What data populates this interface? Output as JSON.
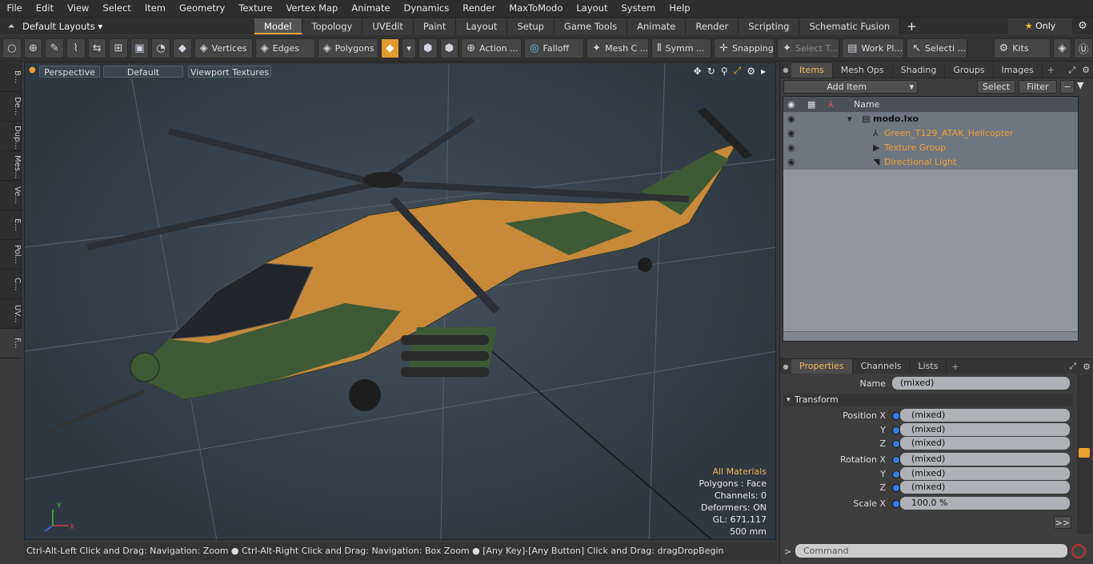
{
  "menu": [
    "File",
    "Edit",
    "View",
    "Select",
    "Item",
    "Geometry",
    "Texture",
    "Vertex Map",
    "Animate",
    "Dynamics",
    "Render",
    "MaxToModo",
    "Layout",
    "System",
    "Help"
  ],
  "layout_selector": "Default Layouts",
  "mode_tabs": [
    "Model",
    "Topology",
    "UVEdit",
    "Paint",
    "Layout",
    "Setup",
    "Game Tools",
    "Animate",
    "Render",
    "Scripting",
    "Schematic Fusion"
  ],
  "active_mode_tab": "Model",
  "only_label": "Only",
  "toolbar": {
    "vertices": "Vertices",
    "edges": "Edges",
    "polygons": "Polygons",
    "action": "Action ...",
    "falloff": "Falloff",
    "mesh": "Mesh C ...",
    "symm": "Symm ...",
    "snapping": "Snapping",
    "select_t": "Select T...",
    "work_pl": "Work Pl...",
    "selecti": "Selecti ...",
    "kits": "Kits"
  },
  "left_tabs": [
    "B...",
    "De...",
    "Dup...",
    "Mes...",
    "Ve...",
    "E...",
    "Pol...",
    "C...",
    "UV...",
    "F..."
  ],
  "viewport": {
    "view": "Perspective",
    "shading": "Default",
    "textures": "Viewport Textures",
    "stats": {
      "materials": "All Materials",
      "polygons": "Polygons : Face",
      "channels": "Channels: 0",
      "deformers": "Deformers: ON",
      "gl": "GL: 671,117",
      "scale": "500 mm"
    }
  },
  "status_text": "Ctrl-Alt-Left Click and Drag: Navigation: Zoom ● Ctrl-Alt-Right Click and Drag: Navigation: Box Zoom ● [Any Key]-[Any Button] Click and Drag: dragDropBegin",
  "items_panel": {
    "tabs": [
      "Items",
      "Mesh Ops",
      "Shading",
      "Groups",
      "Images"
    ],
    "add_item": "Add Item",
    "select": "Select",
    "filter": "Filter",
    "name_col": "Name",
    "scene": "modo.lxo",
    "items": [
      "Green_T129_ATAK_Helicopter",
      "Texture Group",
      "Directional Light"
    ]
  },
  "properties": {
    "tabs": [
      "Properties",
      "Channels",
      "Lists"
    ],
    "name_label": "Name",
    "name_value": "(mixed)",
    "section": "Transform",
    "position_label": "Position X",
    "rotation_label": "Rotation X",
    "scale_label": "Scale X",
    "y": "Y",
    "z": "Z",
    "mixed": "(mixed)",
    "scale_value": "100.0 %"
  },
  "command_placeholder": "Command"
}
